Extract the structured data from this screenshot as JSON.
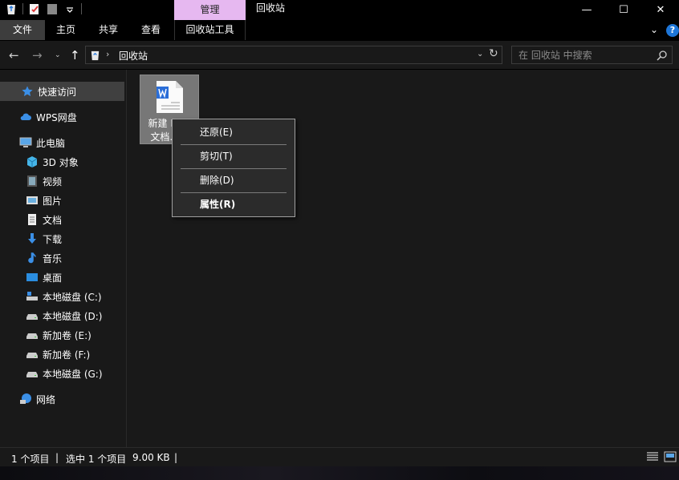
{
  "titlebar": {
    "context_tab": "管理",
    "window_title": "回收站",
    "quick_access_icons": [
      "recycle-bin-icon",
      "properties-icon",
      "new-folder-icon",
      "customize-qat-icon"
    ],
    "minimize_glyph": "—",
    "maximize_glyph": "☐",
    "close_glyph": "✕"
  },
  "ribbon": {
    "tabs": [
      {
        "label": "文件"
      },
      {
        "label": "主页"
      },
      {
        "label": "共享"
      },
      {
        "label": "查看"
      },
      {
        "label": "回收站工具"
      }
    ],
    "expand_glyph": "⌄",
    "help_glyph": "?"
  },
  "address": {
    "back_glyph": "←",
    "forward_glyph": "→",
    "recent_glyph": "⌄",
    "up_glyph": "↑",
    "separator": "›",
    "crumb": "回收站",
    "dropdown_glyph": "⌄",
    "refresh_glyph": "↻",
    "search_placeholder": "在 回收站 中搜索"
  },
  "sidebar": {
    "items": [
      {
        "label": "快速访问",
        "icon": "star-icon",
        "selected": true
      },
      {
        "label": "WPS网盘",
        "icon": "cloud-icon"
      },
      {
        "label": "此电脑",
        "icon": "computer-icon"
      },
      {
        "label": "3D 对象",
        "icon": "cube-icon"
      },
      {
        "label": "视频",
        "icon": "video-icon"
      },
      {
        "label": "图片",
        "icon": "picture-icon"
      },
      {
        "label": "文档",
        "icon": "document-icon"
      },
      {
        "label": "下载",
        "icon": "download-icon"
      },
      {
        "label": "音乐",
        "icon": "music-icon"
      },
      {
        "label": "桌面",
        "icon": "desktop-icon"
      },
      {
        "label": "本地磁盘 (C:)",
        "icon": "system-drive-icon"
      },
      {
        "label": "本地磁盘 (D:)",
        "icon": "drive-icon"
      },
      {
        "label": "新加卷 (E:)",
        "icon": "drive-icon"
      },
      {
        "label": "新加卷 (F:)",
        "icon": "drive-icon"
      },
      {
        "label": "本地磁盘 (G:)",
        "icon": "drive-icon"
      },
      {
        "label": "网络",
        "icon": "network-icon"
      }
    ]
  },
  "content": {
    "file": {
      "name_line1": "新建 DOC",
      "name_line2": "文档.doc",
      "icon": "word-document-icon"
    },
    "context_menu": {
      "items": [
        {
          "label": "还原(E)"
        },
        {
          "label": "剪切(T)"
        },
        {
          "label": "删除(D)"
        },
        {
          "label": "属性(R)",
          "bold": true
        }
      ]
    }
  },
  "status": {
    "count": "1 个项目",
    "sep1": "|",
    "selected": "选中 1 个项目",
    "size": "9.00 KB",
    "sep2": "|",
    "view_buttons": [
      "details-view-icon",
      "large-icons-view-icon"
    ]
  },
  "colors": {
    "background": "#191919",
    "chrome": "#000000",
    "context_tab": "#e6b8f0",
    "selected_item": "#404040",
    "accent_blue": "#1e76d8"
  }
}
